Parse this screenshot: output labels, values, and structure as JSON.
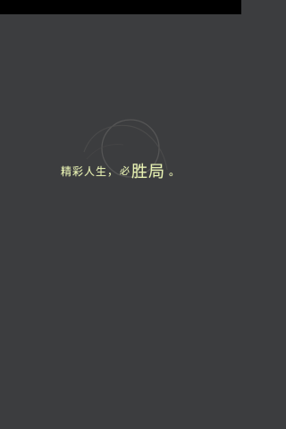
{
  "slogan": {
    "part1": "精彩人生，",
    "part2": "必",
    "part3": "胜局",
    "part4": "。"
  },
  "colors": {
    "background": "#3c3d3f",
    "status_bar": "#000000",
    "slogan": "#e8f3b2",
    "ring": "#5a5a5a"
  }
}
